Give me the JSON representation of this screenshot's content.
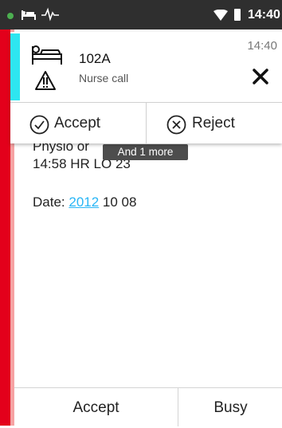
{
  "status_bar": {
    "time": "14:40",
    "icons": [
      "notification-dot-icon",
      "bed-icon",
      "pulse-icon",
      "wifi-icon",
      "battery-icon"
    ]
  },
  "background_screen": {
    "line1": "Physio or",
    "line2": "14:58 HR LO 23",
    "date_label": "Date: ",
    "date_year": "2012",
    "date_rest": " 10 08",
    "toast": "And 1 more",
    "bottom_actions": {
      "accept_label": "Accept",
      "busy_label": "Busy"
    }
  },
  "notification": {
    "room": "102A",
    "subtitle": "Nurse call",
    "time": "14:40",
    "accept_label": "Accept",
    "reject_label": "Reject",
    "accent_color": "#2ee6f0"
  },
  "colors": {
    "alarm_red": "#e3001b",
    "link_blue": "#29b6f6",
    "status_bar": "#2f2f2f"
  }
}
